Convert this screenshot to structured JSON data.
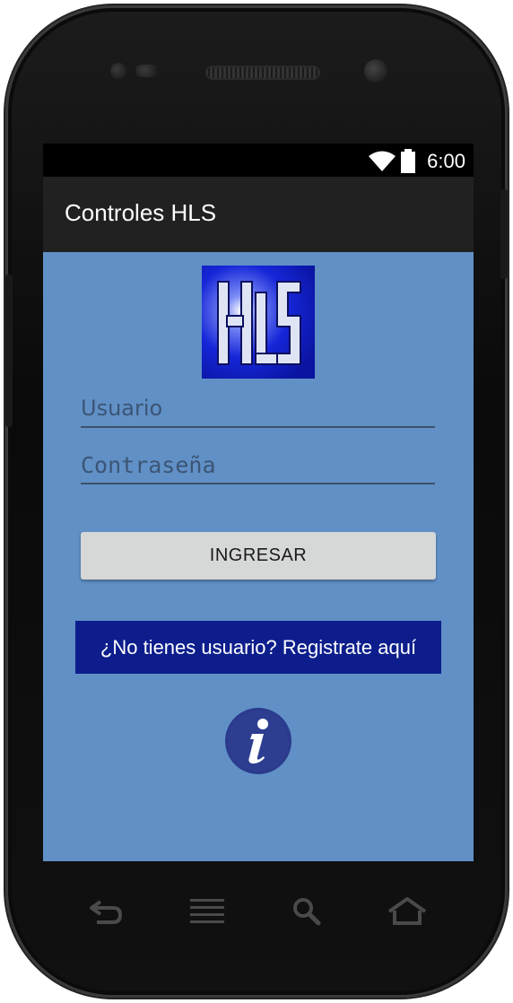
{
  "status_bar": {
    "time": "6:00",
    "wifi_icon": "wifi-icon",
    "battery_icon": "battery-icon"
  },
  "app_bar": {
    "title": "Controles HLS"
  },
  "logo": {
    "text": "HLS",
    "background_color": "#1020c0",
    "letter_color": "#e8ecf6"
  },
  "form": {
    "username_placeholder": "Usuario",
    "username_value": "",
    "password_placeholder": "Contraseña",
    "password_value": ""
  },
  "login_button": {
    "label": "INGRESAR"
  },
  "register_button": {
    "label": "¿No tienes usuario? Registrate aquí",
    "background_color": "#0d1e8c"
  },
  "info_button": {
    "icon": "info-icon",
    "glyph": "i",
    "color": "#2b3a8c"
  },
  "nav_bar": {
    "icons": [
      "back-icon",
      "menu-icon",
      "search-icon",
      "home-icon"
    ]
  },
  "colors": {
    "screen_background": "#6090c6",
    "app_bar_background": "#212121",
    "status_bar_background": "#000000"
  }
}
